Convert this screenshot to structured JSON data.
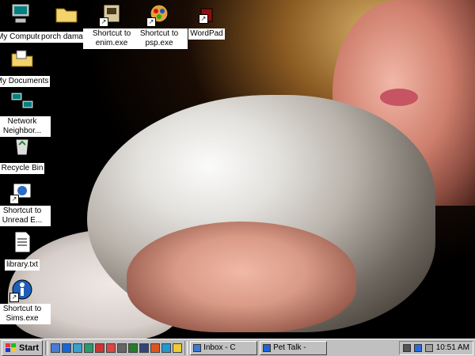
{
  "desktop": {
    "icons": [
      {
        "label": "My Computer",
        "icon": "computer-icon"
      },
      {
        "label": "porch damage",
        "icon": "folder-icon"
      },
      {
        "label": "Shortcut to enim.exe",
        "icon": "app-icon"
      },
      {
        "label": "Shortcut to psp.exe",
        "icon": "paint-app-icon"
      },
      {
        "label": "WordPad",
        "icon": "wordpad-icon"
      },
      {
        "label": "My Documents",
        "icon": "documents-folder-icon"
      },
      {
        "label": "Network Neighbor...",
        "icon": "network-icon"
      },
      {
        "label": "Recycle Bin",
        "icon": "recycle-bin-icon"
      },
      {
        "label": "Shortcut to Unread E...",
        "icon": "email-icon"
      },
      {
        "label": "library.txt",
        "icon": "text-file-icon"
      },
      {
        "label": "Shortcut to Sims.exe",
        "icon": "game-icon"
      }
    ]
  },
  "taskbar": {
    "start_label": "Start",
    "tasks": [
      {
        "label": "Inbox - C",
        "icon": "mail-app-icon"
      },
      {
        "label": "Pet Talk -",
        "icon": "browser-icon"
      }
    ],
    "clock": "10:51 AM"
  }
}
